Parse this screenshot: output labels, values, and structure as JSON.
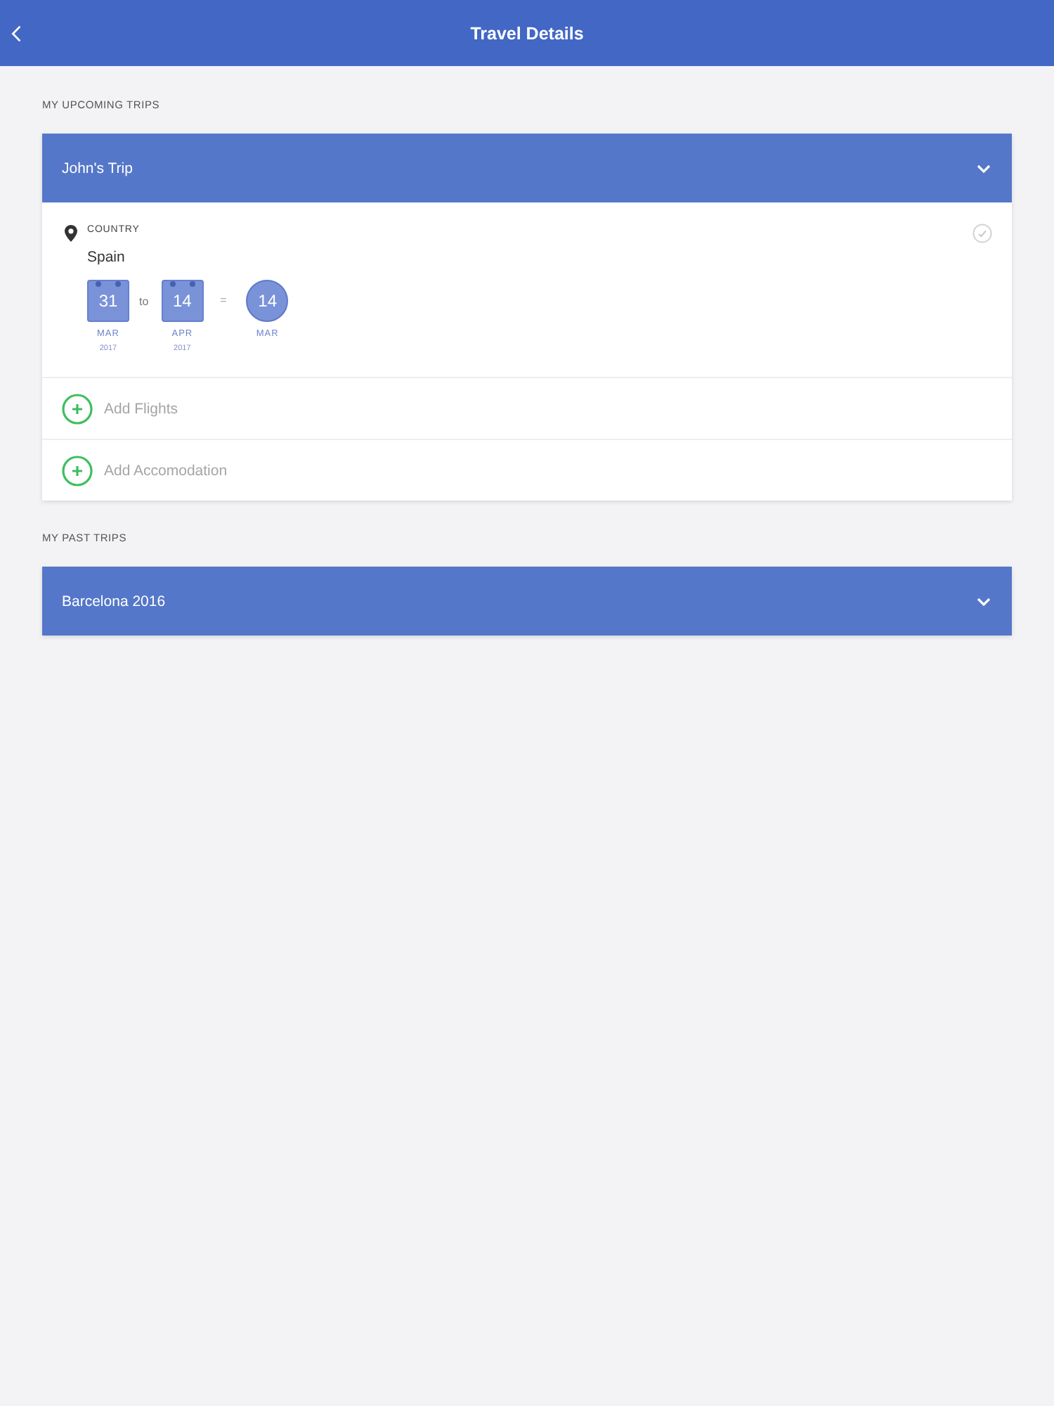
{
  "header": {
    "title": "Travel Details"
  },
  "sections": [
    {
      "heading": "MY UPCOMING TRIPS",
      "trips": [
        {
          "title": "John's Trip",
          "expanded": true,
          "details": {
            "country_label": "COUNTRY",
            "country": "Spain",
            "start": {
              "day": "31",
              "month": "MAR",
              "year": "2017"
            },
            "range_word": "to",
            "end": {
              "day": "14",
              "month": "APR",
              "year": "2017"
            },
            "equals": "=",
            "result": {
              "day": "14",
              "month": "MAR"
            }
          },
          "actions": [
            {
              "label": "Add Flights"
            },
            {
              "label": "Add Accomodation"
            }
          ]
        }
      ]
    },
    {
      "heading": "MY PAST TRIPS",
      "trips": [
        {
          "title": "Barcelona 2016",
          "expanded": false
        }
      ]
    }
  ]
}
